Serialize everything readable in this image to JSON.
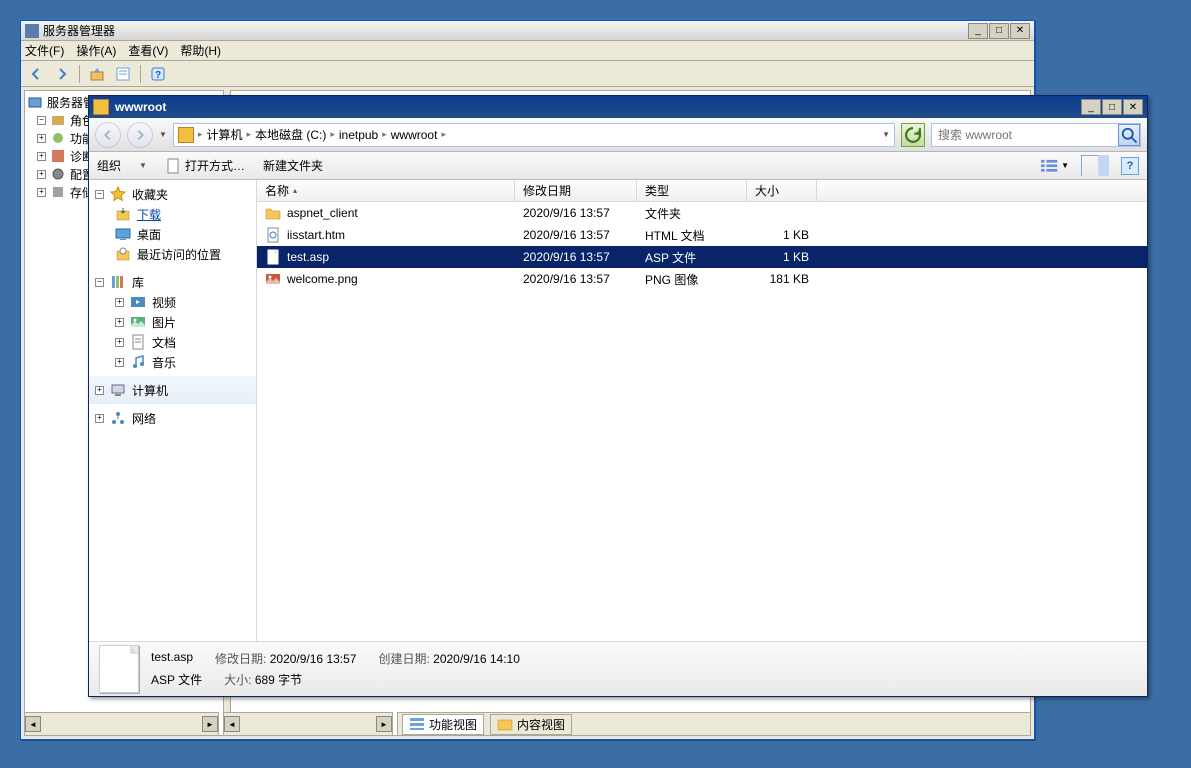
{
  "serverManager": {
    "title": "服务器管理器",
    "menu": {
      "file": "文件(F)",
      "action": "操作(A)",
      "view": "查看(V)",
      "help": "帮助(H)"
    },
    "tree": {
      "root": "服务器管理器",
      "roles": "角色",
      "features": "功能",
      "diagnostics": "诊断",
      "config": "配置",
      "storage": "存储"
    },
    "tabs": {
      "features": "功能视图",
      "content": "内容视图"
    }
  },
  "explorer": {
    "title": "wwwroot",
    "breadcrumb": {
      "parts": [
        "计算机",
        "本地磁盘 (C:)",
        "inetpub",
        "wwwroot"
      ]
    },
    "searchPlaceholder": "搜索 wwwroot",
    "toolbar": {
      "organize": "组织",
      "openWith": "打开方式…",
      "newFolder": "新建文件夹"
    },
    "columns": {
      "name": "名称",
      "date": "修改日期",
      "type": "类型",
      "size": "大小"
    },
    "sidebar": {
      "favorites": "收藏夹",
      "downloads": "下载",
      "desktop": "桌面",
      "recent": "最近访问的位置",
      "libraries": "库",
      "videos": "视频",
      "pictures": "图片",
      "documents": "文档",
      "music": "音乐",
      "computer": "计算机",
      "network": "网络"
    },
    "files": [
      {
        "name": "aspnet_client",
        "date": "2020/9/16 13:57",
        "type": "文件夹",
        "size": "",
        "icon": "folder"
      },
      {
        "name": "iisstart.htm",
        "date": "2020/9/16 13:57",
        "type": "HTML 文档",
        "size": "1 KB",
        "icon": "html"
      },
      {
        "name": "test.asp",
        "date": "2020/9/16 13:57",
        "type": "ASP 文件",
        "size": "1 KB",
        "icon": "file",
        "selected": true
      },
      {
        "name": "welcome.png",
        "date": "2020/9/16 13:57",
        "type": "PNG 图像",
        "size": "181 KB",
        "icon": "image"
      }
    ],
    "details": {
      "name": "test.asp",
      "modLabel": "修改日期:",
      "modValue": "2020/9/16 13:57",
      "createLabel": "创建日期:",
      "createValue": "2020/9/16 14:10",
      "typeLine": "ASP 文件",
      "sizeLabel": "大小:",
      "sizeValue": "689 字节"
    }
  }
}
